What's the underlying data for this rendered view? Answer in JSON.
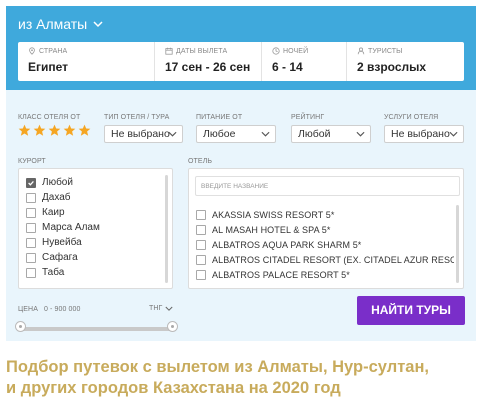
{
  "departure": {
    "city": "из Алматы"
  },
  "search": {
    "country": {
      "label": "СТРАНА",
      "value": "Египет"
    },
    "dates": {
      "label": "ДАТЫ ВЫЛЕТА",
      "value": "17 сен - 26 сен"
    },
    "nights": {
      "label": "НОЧЕЙ",
      "value": "6 - 14"
    },
    "tourists": {
      "label": "ТУРИСТЫ",
      "value": "2 взрослых"
    }
  },
  "filters": {
    "hotel_class": {
      "label": "КЛАСС ОТЕЛЯ ОТ",
      "stars": 5
    },
    "hotel_type": {
      "label": "ТИП ОТЕЛЯ / ТУРА",
      "value": "Не выбрано"
    },
    "meal": {
      "label": "ПИТАНИЕ ОТ",
      "value": "Любое"
    },
    "rating": {
      "label": "РЕЙТИНГ",
      "value": "Любой"
    },
    "services": {
      "label": "УСЛУГИ ОТЕЛЯ",
      "value": "Не выбрано"
    }
  },
  "resort": {
    "label": "КУРОРТ",
    "items": [
      {
        "name": "Любой",
        "checked": true
      },
      {
        "name": "Дахаб",
        "checked": false
      },
      {
        "name": "Каир",
        "checked": false
      },
      {
        "name": "Марса Алам",
        "checked": false
      },
      {
        "name": "Нувейба",
        "checked": false
      },
      {
        "name": "Сафага",
        "checked": false
      },
      {
        "name": "Таба",
        "checked": false
      }
    ]
  },
  "hotel": {
    "label": "ОТЕЛЬ",
    "placeholder": "ВВЕДИТЕ НАЗВАНИЕ",
    "items": [
      "AKASSIA SWISS RESORT 5*",
      "AL MASAH HOTEL & SPA 5*",
      "ALBATROS AQUA PARK SHARM 5*",
      "ALBATROS CITADEL RESORT (EX. CITADEL AZUR RESORT)...",
      "ALBATROS PALACE RESORT 5*"
    ]
  },
  "price": {
    "label": "ЦЕНА",
    "range": "0 - 900 000",
    "currency": "ТНГ",
    "min_fraction": 0,
    "max_fraction": 1
  },
  "submit_label": "НАЙТИ ТУРЫ",
  "headline": {
    "line1": "Подбор путевок с вылетом из Алматы, Нур-султан,",
    "line2": "и других городов Казахстана на 2020 год"
  },
  "colors": {
    "topbar": "#3fa9dc",
    "panel": "#e9f5fc",
    "star": "#f5a623",
    "button": "#7a2ec9",
    "headline": "#c8ab5c"
  }
}
